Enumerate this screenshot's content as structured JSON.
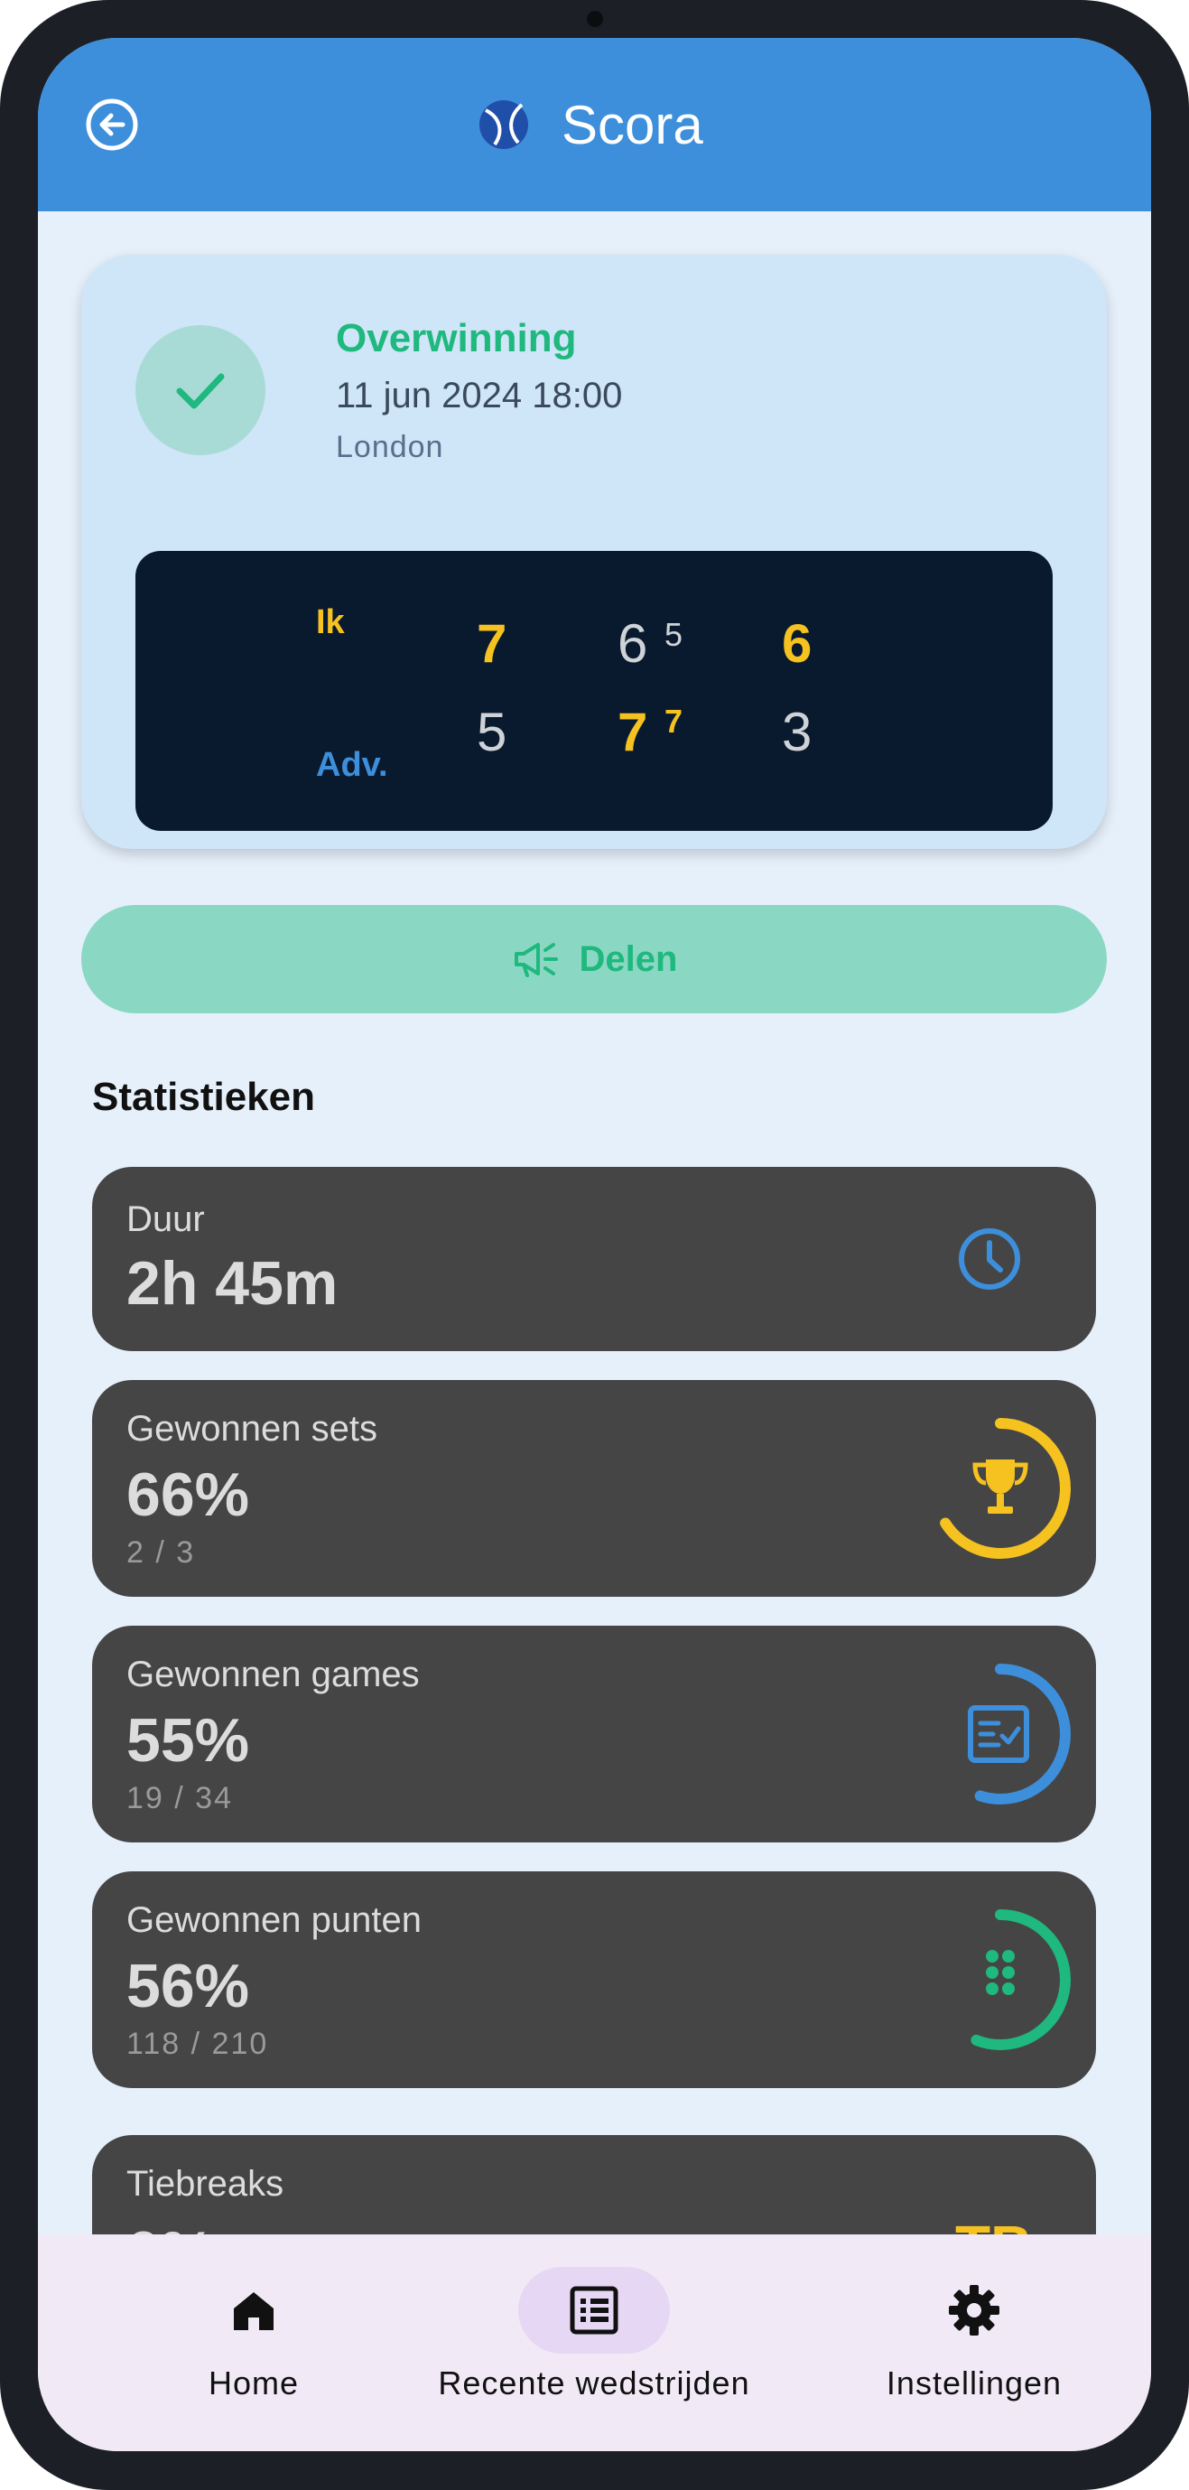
{
  "app": {
    "title": "Scora"
  },
  "match": {
    "result": "Overwinning",
    "datetime": "11 jun 2024 18:00",
    "location": "London",
    "players": {
      "me": "Ik",
      "opponent": "Adv."
    },
    "sets": [
      {
        "me": "7",
        "opponent": "5",
        "me_tiebreak": "",
        "opponent_tiebreak": ""
      },
      {
        "me": "6",
        "opponent": "7",
        "me_tiebreak": "5",
        "opponent_tiebreak": "7"
      },
      {
        "me": "6",
        "opponent": "3",
        "me_tiebreak": "",
        "opponent_tiebreak": ""
      }
    ]
  },
  "share": {
    "label": "Delen"
  },
  "stats": {
    "title": "Statistieken",
    "duration": {
      "label": "Duur",
      "value": "2h 45m"
    },
    "sets": {
      "label": "Gewonnen sets",
      "value": "66%",
      "detail": "2 / 3",
      "progress": 0.66
    },
    "games": {
      "label": "Gewonnen games",
      "value": "55%",
      "detail": "19 / 34",
      "progress": 0.55
    },
    "points": {
      "label": "Gewonnen punten",
      "value": "56%",
      "detail": "118 / 210",
      "progress": 0.56
    },
    "tiebreaks": {
      "label": "Tiebreaks",
      "badge": "TB"
    }
  },
  "colors": {
    "sets": "#f5c220",
    "games": "#3d8fdb",
    "points": "#1fb87e"
  },
  "nav": {
    "items": [
      {
        "label": "Home",
        "icon": "home-icon"
      },
      {
        "label": "Recente wedstrijden",
        "icon": "list-icon",
        "active": true
      },
      {
        "label": "Instellingen",
        "icon": "gear-icon"
      }
    ]
  }
}
